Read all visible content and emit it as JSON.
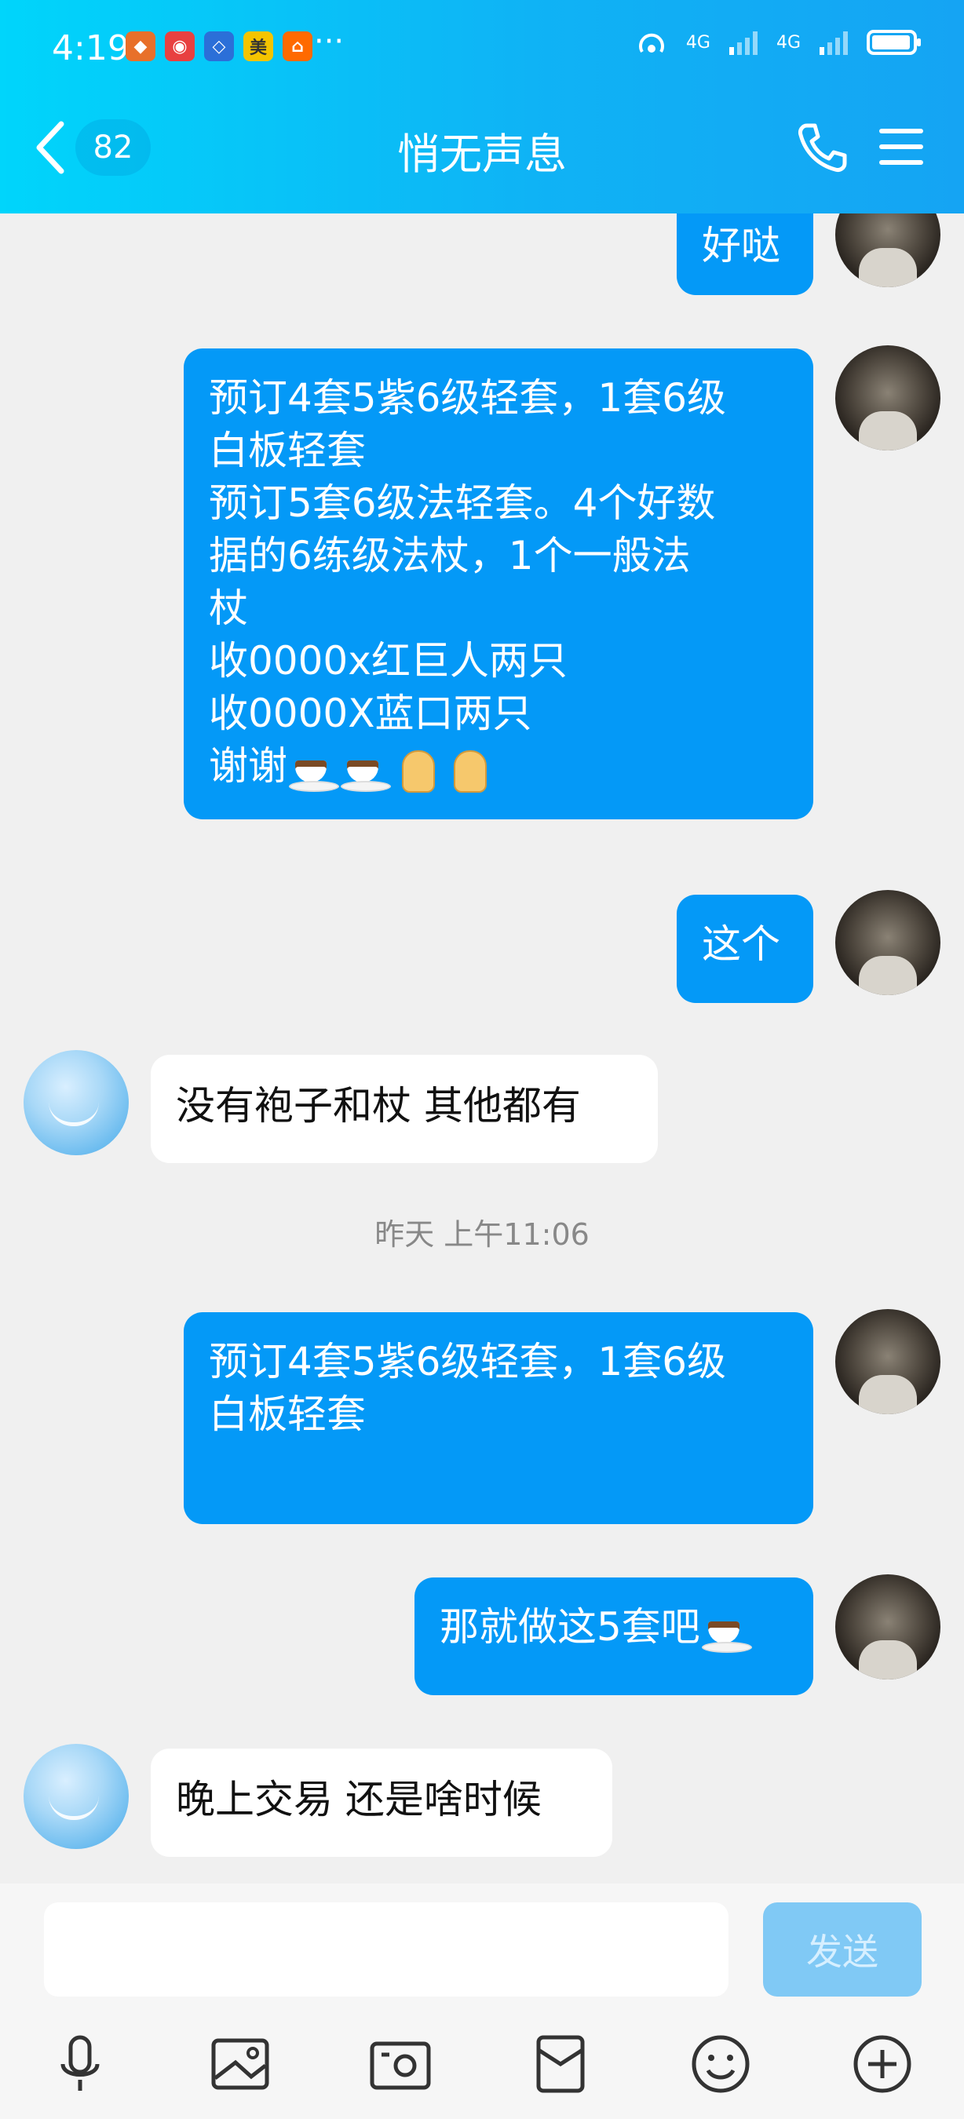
{
  "status_bar": {
    "time": "4:19",
    "dots": "···",
    "net1": "4G",
    "net2": "4G"
  },
  "header": {
    "unread_count": "82",
    "title": "悄无声息"
  },
  "messages": [
    {
      "text": "好哒"
    },
    {
      "text": "预订4套5紫6级轻套，1套6级\n白板轻套\n预订5套6级法轻套。4个好数\n据的6练级法杖，1个一般法\n杖\n收0000x红巨人两只\n收0000X蓝口两只\n谢谢"
    },
    {
      "text": "这个"
    },
    {
      "text": "没有袍子和杖 其他都有"
    },
    {
      "text": "预订4套5紫6级轻套，1套6级\n白板轻套"
    },
    {
      "text": "那就做这5套吧"
    },
    {
      "text": "晚上交易 还是啥时候"
    }
  ],
  "timestamp": "昨天 上午11:06",
  "input": {
    "send_label": "发送",
    "placeholder": ""
  },
  "colors": {
    "header_start": "#00d5fb",
    "header_end": "#15a4f3",
    "bubble_out": "#0499f7",
    "bubble_in": "#ffffff",
    "send_disabled": "#80c9f5"
  },
  "icons": [
    "mic-icon",
    "image-icon",
    "camera-icon",
    "red-packet-icon",
    "emoji-icon",
    "plus-icon"
  ]
}
